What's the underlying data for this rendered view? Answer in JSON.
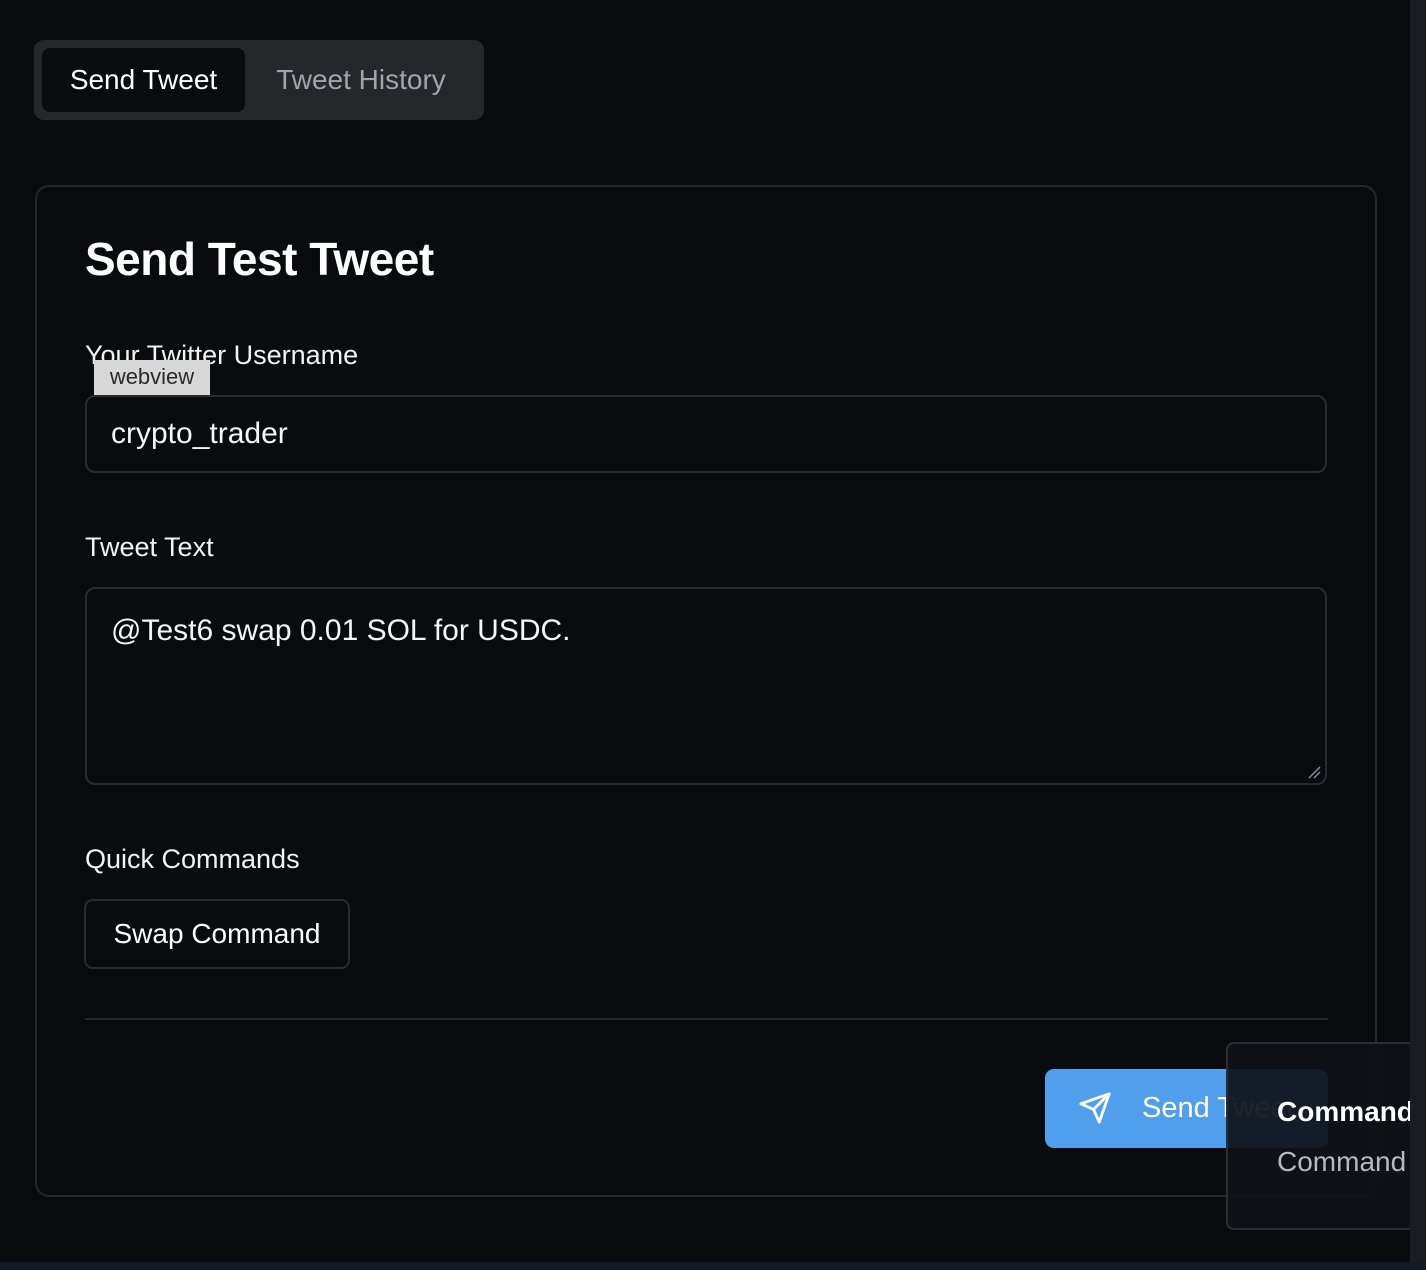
{
  "tabs": {
    "send_tweet": "Send Tweet",
    "tweet_history": "Tweet History"
  },
  "card": {
    "title": "Send Test Tweet",
    "username_label": "Your Twitter Username",
    "username_value": "crypto_trader",
    "tweet_text_label": "Tweet Text",
    "tweet_text_value": "@Test6 swap 0.01 SOL for USDC.",
    "quick_commands_label": "Quick Commands",
    "quick_commands": [
      {
        "label": "Swap Command"
      }
    ],
    "send_button_label": "Send Tweet",
    "send_icon": "send-icon"
  },
  "webview_tag": "webview",
  "popup": {
    "title": "Command",
    "subtitle": "Command"
  },
  "colors": {
    "background": "#0a0b0e",
    "accent": "#4f9fec",
    "border": "#2a2b30"
  }
}
